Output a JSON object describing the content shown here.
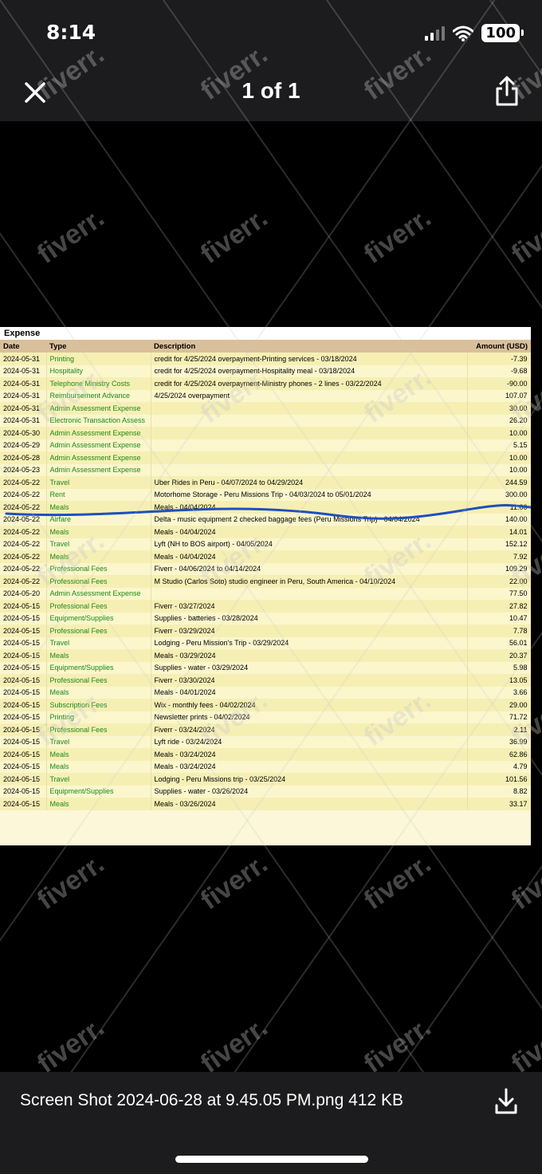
{
  "status_bar": {
    "time": "8:14",
    "battery": "100"
  },
  "nav": {
    "title": "1 of 1"
  },
  "document": {
    "title": "Expense",
    "columns": [
      "Date",
      "Type",
      "Description",
      "Amount (USD)"
    ],
    "rows": [
      [
        "2024-05-31",
        "Printing",
        "credit for 4/25/2024 overpayment-Printing services - 03/18/2024",
        "-7.39"
      ],
      [
        "2024-05-31",
        "Hospitality",
        "credit for 4/25/2024 overpayment-Hospitality meal - 03/18/2024",
        "-9.68"
      ],
      [
        "2024-05-31",
        "Telephone Ministry Costs",
        "credit for 4/25/2024 overpayment-Ministry phones - 2 lines - 03/22/2024",
        "-90.00"
      ],
      [
        "2024-05-31",
        "Reimbursement Advance",
        "4/25/2024 overpayment",
        "107.07"
      ],
      [
        "2024-05-31",
        "Admin Assessment Expense",
        "",
        "30.00"
      ],
      [
        "2024-05-31",
        "Electronic Transaction Assess",
        "",
        "26.20"
      ],
      [
        "2024-05-30",
        "Admin Assessment Expense",
        "",
        "10.00"
      ],
      [
        "2024-05-29",
        "Admin Assessment Expense",
        "",
        "5.15"
      ],
      [
        "2024-05-28",
        "Admin Assessment Expense",
        "",
        "10.00"
      ],
      [
        "2024-05-23",
        "Admin Assessment Expense",
        "",
        "10.00"
      ],
      [
        "2024-05-22",
        "Travel",
        "Uber Rides in Peru - 04/07/2024 to 04/29/2024",
        "244.59"
      ],
      [
        "2024-05-22",
        "Rent",
        "Motorhome Storage - Peru Missions Trip - 04/03/2024 to 05/01/2024",
        "300.00"
      ],
      [
        "2024-05-22",
        "Meals",
        "Meals - 04/04/2024",
        "11.00"
      ],
      [
        "2024-05-22",
        "Airfare",
        "Delta - music equipment 2 checked baggage fees (Peru Missions Trip) - 04/04/2024",
        "140.00"
      ],
      [
        "2024-05-22",
        "Meals",
        "Meals - 04/04/2024",
        "14.01"
      ],
      [
        "2024-05-22",
        "Travel",
        "Lyft (NH to BOS airport) - 04/05/2024",
        "152.12"
      ],
      [
        "2024-05-22",
        "Meals",
        "Meals - 04/04/2024",
        "7.92"
      ],
      [
        "2024-05-22",
        "Professional Fees",
        "Fiverr - 04/06/2024 to 04/14/2024",
        "109.29"
      ],
      [
        "2024-05-22",
        "Professional Fees",
        "M Studio (Carlos Soto) studio engineer in Peru, South America - 04/10/2024",
        "22.00"
      ],
      [
        "2024-05-20",
        "Admin Assessment Expense",
        "",
        "77.50"
      ],
      [
        "2024-05-15",
        "Professional Fees",
        "Fiverr - 03/27/2024",
        "27.82"
      ],
      [
        "2024-05-15",
        "Equipment/Supplies",
        "Supplies - batteries - 03/28/2024",
        "10.47"
      ],
      [
        "2024-05-15",
        "Professional Fees",
        "Fiverr - 03/29/2024",
        "7.78"
      ],
      [
        "2024-05-15",
        "Travel",
        "Lodging - Peru Mission's Trip - 03/29/2024",
        "56.01"
      ],
      [
        "2024-05-15",
        "Meals",
        "Meals - 03/29/2024",
        "20.37"
      ],
      [
        "2024-05-15",
        "Equipment/Supplies",
        "Supplies - water - 03/29/2024",
        "5.98"
      ],
      [
        "2024-05-15",
        "Professional Fees",
        "Fiverr - 03/30/2024",
        "13.05"
      ],
      [
        "2024-05-15",
        "Meals",
        "Meals - 04/01/2024",
        "3.66"
      ],
      [
        "2024-05-15",
        "Subscription Fees",
        "Wix - monthly fees - 04/02/2024",
        "29.00"
      ],
      [
        "2024-05-15",
        "Printing",
        "Newsletter prints - 04/02/2024",
        "71.72"
      ],
      [
        "2024-05-15",
        "Professional Fees",
        "Fiverr - 03/24/2024",
        "2.11"
      ],
      [
        "2024-05-15",
        "Travel",
        "Lyft ride - 03/24/2024",
        "36.99"
      ],
      [
        "2024-05-15",
        "Meals",
        "Meals - 03/24/2024",
        "62.86"
      ],
      [
        "2024-05-15",
        "Meals",
        "Meals - 03/24/2024",
        "4.79"
      ],
      [
        "2024-05-15",
        "Travel",
        "Lodging - Peru Missions trip - 03/25/2024",
        "101.56"
      ],
      [
        "2024-05-15",
        "Equipment/Supplies",
        "Supplies - water - 03/26/2024",
        "8.82"
      ],
      [
        "2024-05-15",
        "Meals",
        "Meals - 03/26/2024",
        "33.17"
      ]
    ]
  },
  "watermark": {
    "text": "fiverr."
  },
  "bottom_bar": {
    "file_info": "Screen Shot 2024-06-28 at 9.45.05 PM.png 412 KB"
  },
  "colors": {
    "bar_bg": "#1c1c1e",
    "type_green": "#1a8a1a",
    "header_tan": "#d9c09a",
    "row_yellow": "#f6efb4",
    "ink_blue": "#1f4fbf"
  },
  "icons": {
    "close": "close-icon",
    "share": "share-icon",
    "download": "download-icon"
  }
}
